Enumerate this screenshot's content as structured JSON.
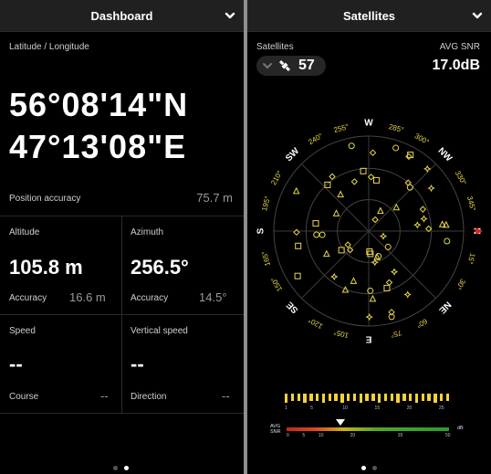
{
  "left": {
    "title": "Dashboard",
    "latlon_label": "Latitude / Longitude",
    "lat": "56°08'14\"N",
    "lon": "47°13'08\"E",
    "pos_acc_label": "Position accuracy",
    "pos_acc_value": "75.7 m",
    "altitude_label": "Altitude",
    "altitude_value": "105.8 m",
    "alt_acc_label": "Accuracy",
    "alt_acc_value": "16.6 m",
    "azimuth_label": "Azimuth",
    "azimuth_value": "256.5°",
    "az_acc_label": "Accuracy",
    "az_acc_value": "14.5°",
    "speed_label": "Speed",
    "speed_value": "--",
    "course_label": "Course",
    "course_value": "--",
    "vspeed_label": "Vertical speed",
    "vspeed_value": "--",
    "direction_label": "Direction",
    "direction_value": "--",
    "page_dots": [
      false,
      true
    ]
  },
  "right": {
    "title": "Satellites",
    "sat_label": "Satellites",
    "sat_count": "57",
    "snr_label": "AVG SNR",
    "snr_value": "17.0dB",
    "compass": {
      "cardinals": [
        {
          "t": "N",
          "deg": 90
        },
        {
          "t": "NE",
          "deg": 135
        },
        {
          "t": "E",
          "deg": 180
        },
        {
          "t": "SE",
          "deg": 225
        },
        {
          "t": "S",
          "deg": 270
        },
        {
          "t": "SW",
          "deg": 315
        },
        {
          "t": "W",
          "deg": 0
        },
        {
          "t": "NW",
          "deg": 45
        }
      ],
      "degree_labels": [
        {
          "t": "15°",
          "deg": 105
        },
        {
          "t": "30°",
          "deg": 120
        },
        {
          "t": "60°",
          "deg": 150
        },
        {
          "t": "75°",
          "deg": 165
        },
        {
          "t": "105°",
          "deg": 195
        },
        {
          "t": "120°",
          "deg": 210
        },
        {
          "t": "150°",
          "deg": 240
        },
        {
          "t": "165°",
          "deg": 255
        },
        {
          "t": "195°",
          "deg": 285
        },
        {
          "t": "210°",
          "deg": 300
        },
        {
          "t": "240°",
          "deg": 330
        },
        {
          "t": "255°",
          "deg": 345
        },
        {
          "t": "285°",
          "deg": 15
        },
        {
          "t": "300°",
          "deg": 30
        },
        {
          "t": "330°",
          "deg": 60
        },
        {
          "t": "345°",
          "deg": 75
        }
      ]
    },
    "snr_scale_label": "AVG\nSNR",
    "snr_unit": "dB",
    "snr_ticks": [
      "0",
      "5",
      "10",
      "20",
      "35",
      "50"
    ],
    "bar_ticks": [
      "1",
      "5",
      "10",
      "15",
      "20",
      "25"
    ],
    "snr_marker_value": 17.0,
    "page_dots": [
      true,
      false
    ]
  }
}
